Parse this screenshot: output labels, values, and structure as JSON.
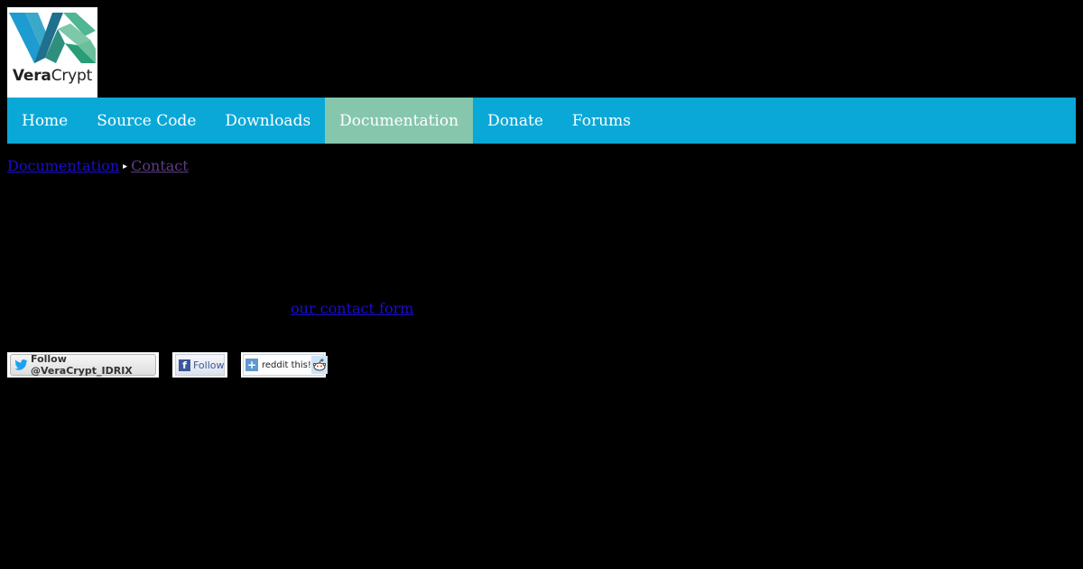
{
  "logo": {
    "brand_bold": "Vera",
    "brand_regular": "Crypt"
  },
  "nav": {
    "items": [
      {
        "label": "Home"
      },
      {
        "label": "Source Code"
      },
      {
        "label": "Downloads"
      },
      {
        "label": "Documentation",
        "active": true
      },
      {
        "label": "Donate"
      },
      {
        "label": "Forums"
      }
    ]
  },
  "breadcrumb": {
    "items": [
      {
        "label": "Documentation"
      },
      {
        "label": "Contact"
      }
    ],
    "separator": "▸"
  },
  "content": {
    "contact_link": "our contact form"
  },
  "social": {
    "twitter_label": "Follow @VeraCrypt_IDRIX",
    "facebook_label": "Follow",
    "reddit_label": "reddit this!"
  },
  "colors": {
    "background": "#000000",
    "nav_bar": "#0aa8d7",
    "nav_active": "#86c6ad",
    "link": "#1a0dcc",
    "visited_link": "#5e3b8a"
  },
  "icons": {
    "twitter": "twitter-bird-icon",
    "facebook": "facebook-f-icon",
    "reddit": "reddit-alien-icon",
    "reddit_add": "plus-icon"
  }
}
